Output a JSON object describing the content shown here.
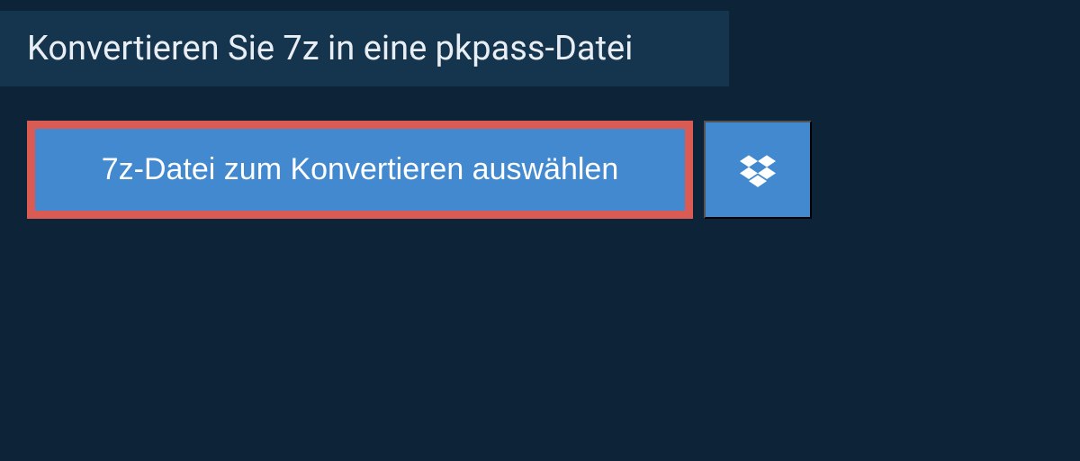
{
  "header": {
    "title": "Konvertieren Sie 7z in eine pkpass-Datei"
  },
  "buttons": {
    "select_file_label": "7z-Datei zum Konvertieren auswählen"
  },
  "colors": {
    "background": "#0d2438",
    "header_bg": "#15344d",
    "button_bg": "#4289d0",
    "highlight_border": "#d95b54"
  }
}
